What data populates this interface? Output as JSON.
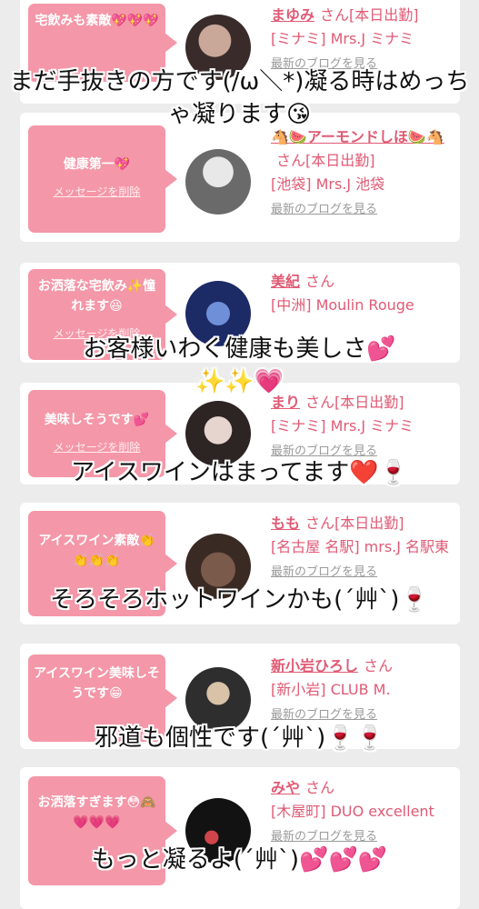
{
  "delete_label": "メッセージを削除",
  "blog_label": "最新のブログを見る",
  "san": "さん",
  "colors": {
    "bubble": "#f497a8",
    "accent": "#e05a74",
    "background": "#ececec"
  },
  "cards": [
    {
      "message": "宅飲みも素敵💖💖💖",
      "name": "まゆみ",
      "status": "[本日出勤]",
      "shop": "[ミナミ] Mrs.J ミナミ"
    },
    {
      "message": "健康第一💖",
      "name": "🐴🍉アーモンドしほ🍉🐴",
      "status": "[本日出勤]",
      "shop": "[池袋] Mrs.J 池袋"
    },
    {
      "message": "お洒落な宅飲み✨憧れます😆",
      "name": "美紀",
      "status": "",
      "shop": "[中洲] Moulin Rouge"
    },
    {
      "message": "美味しそうです💕",
      "name": "まり",
      "status": "[本日出勤]",
      "shop": "[ミナミ] Mrs.J ミナミ"
    },
    {
      "message": "アイスワイン素敵👏👏👏👏",
      "name": "もも",
      "status": "[本日出勤]",
      "shop": "[名古屋 名駅] mrs.J 名駅東"
    },
    {
      "message": "アイスワイン美味しそうです😁",
      "name": "新小岩ひろし",
      "status": "",
      "shop": "[新小岩] CLUB M."
    },
    {
      "message": "お洒落すぎます😳🙈💗💗💗",
      "name": "みや",
      "status": "",
      "shop": "[木屋町] DUO excellent"
    }
  ],
  "captions": [
    "まだ手抜きの方です(/ω＼*)凝る時はめっちゃ凝ります😘",
    "お客様いわく健康も美しさ💕✨✨💗",
    "アイスワインはまってます❤️🍷",
    "そろそろホットワインかも(´艸`)🍷",
    "邪道も個性です(´艸`)🍷🍷",
    "もっと凝るよ(´艸`)💕💕💕"
  ]
}
